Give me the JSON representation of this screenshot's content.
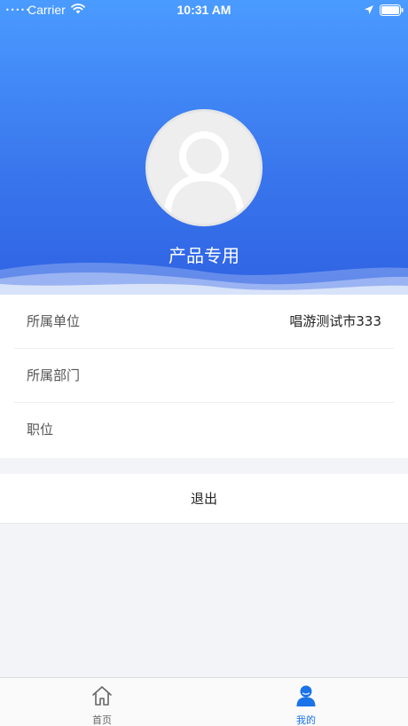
{
  "status_bar": {
    "signal": "•••••",
    "carrier": "Carrier",
    "time": "10:31 AM"
  },
  "profile": {
    "name": "产品专用"
  },
  "info": [
    {
      "label": "所属单位",
      "value": "唱游测试市333"
    },
    {
      "label": "所属部门",
      "value": ""
    },
    {
      "label": "职位",
      "value": ""
    }
  ],
  "logout_label": "退出",
  "tabbar": {
    "tabs": [
      {
        "label": "首页",
        "icon": "home-icon",
        "active": false
      },
      {
        "label": "我的",
        "icon": "person-icon",
        "active": true
      }
    ],
    "active_color": "#1a73e8",
    "inactive_color": "#666666"
  },
  "colors": {
    "header_top": "#4a9bff",
    "header_bottom": "#2f62e3",
    "background": "#f3f4f8"
  }
}
